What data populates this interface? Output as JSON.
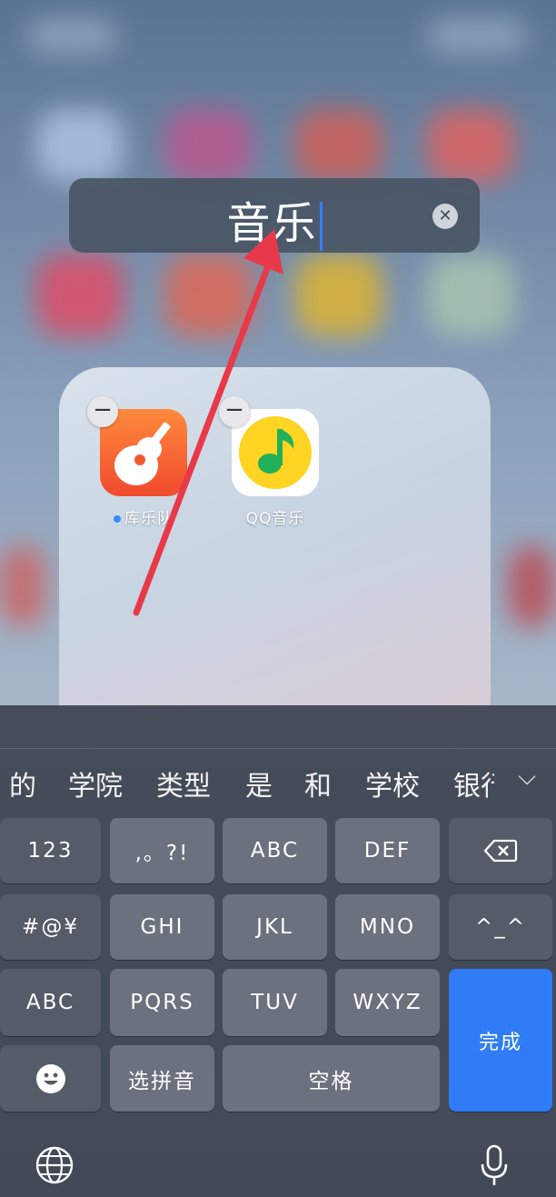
{
  "folder": {
    "title": "音乐",
    "apps": [
      {
        "label": "库乐队",
        "icon": "garageband-icon",
        "new_dot": true
      },
      {
        "label": "QQ音乐",
        "icon": "qq-music-icon",
        "new_dot": false
      }
    ]
  },
  "keyboard": {
    "candidates": [
      "的",
      "学院",
      "类型",
      "是",
      "和",
      "学校",
      "银行"
    ],
    "keys": {
      "num": "123",
      "punct": ",。?!",
      "abc1": "ABC",
      "def": "DEF",
      "symbols": "#@¥",
      "ghi": "GHI",
      "jkl": "JKL",
      "mno": "MNO",
      "emoticon": "^_^",
      "abc2": "ABC",
      "pqrs": "PQRS",
      "tuv": "TUV",
      "wxyz": "WXYZ",
      "done": "完成",
      "select_pinyin": "选拼音",
      "space": "空格"
    }
  },
  "colors": {
    "accent": "#2f7cf6",
    "arrow": "#e8394a"
  }
}
